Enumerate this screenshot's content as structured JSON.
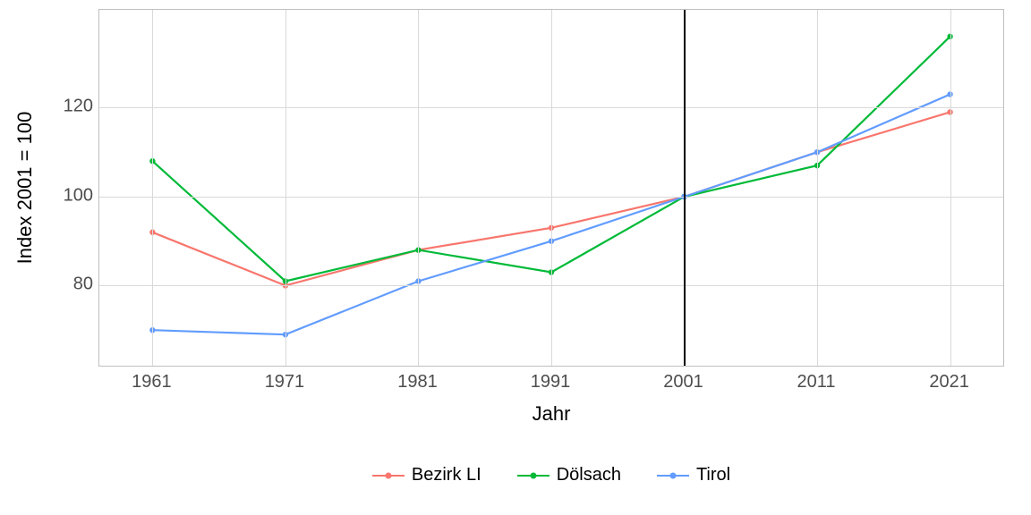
{
  "chart_data": {
    "type": "line",
    "title": "",
    "xlabel": "Jahr",
    "ylabel": "Index 2001 = 100",
    "x": [
      1961,
      1971,
      1981,
      1991,
      2001,
      2011,
      2021
    ],
    "series": [
      {
        "name": "Bezirk LI",
        "color": "#F8766D",
        "values": [
          92,
          80,
          88,
          93,
          100,
          110,
          119
        ]
      },
      {
        "name": "Dölsach",
        "color": "#00BA38",
        "values": [
          108,
          81,
          88,
          83,
          100,
          107,
          136
        ]
      },
      {
        "name": "Tirol",
        "color": "#619CFF",
        "values": [
          70,
          69,
          81,
          90,
          100,
          110,
          123
        ]
      }
    ],
    "y_ticks": [
      80,
      100,
      120
    ],
    "x_ticks": [
      1961,
      1971,
      1981,
      1991,
      2001,
      2011,
      2021
    ],
    "xlim": [
      1957,
      2025
    ],
    "ylim": [
      62,
      142
    ],
    "vline_x": 2001,
    "legend_position": "bottom",
    "grid": true
  }
}
